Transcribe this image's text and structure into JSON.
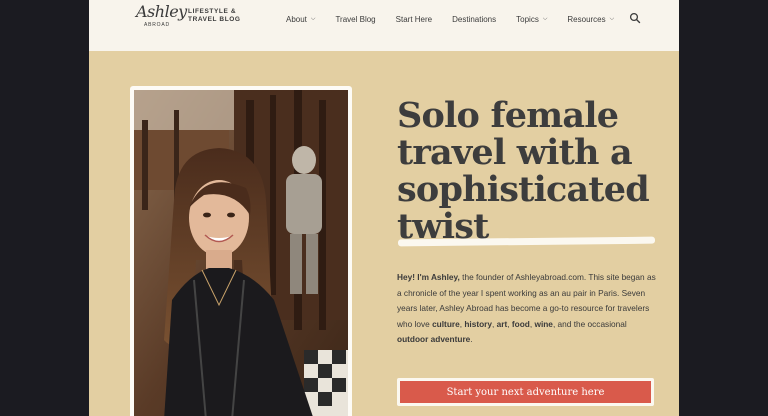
{
  "logo": {
    "script": "Ashley",
    "sub": "ABROAD",
    "tagline_line1": "LIFESTYLE &",
    "tagline_line2": "TRAVEL BLOG"
  },
  "nav": {
    "items": [
      {
        "label": "About",
        "has_dropdown": true
      },
      {
        "label": "Travel Blog",
        "has_dropdown": false
      },
      {
        "label": "Start Here",
        "has_dropdown": false
      },
      {
        "label": "Destinations",
        "has_dropdown": false
      },
      {
        "label": "Topics",
        "has_dropdown": true
      },
      {
        "label": "Resources",
        "has_dropdown": true
      }
    ],
    "search_icon": "search-icon"
  },
  "hero": {
    "title": "Solo female travel with a sophisticated twist",
    "intro": {
      "greeting": "Hey! I'm Ashley,",
      "part1": " the founder of Ashleyabroad.com. This site began as a chronicle of the year I spent working as an au pair in Paris. Seven years later, Ashley Abroad has become a go-to resource for travelers who love ",
      "culture": "culture",
      "sep1": ", ",
      "history": "history",
      "sep2": ", ",
      "art": "art",
      "sep3": ", ",
      "food": "food",
      "sep4": ", ",
      "wine": "wine",
      "part2": ", and the occasional ",
      "outdoor": "outdoor adventure",
      "end": "."
    },
    "cta_label": "Start your next adventure here"
  },
  "colors": {
    "hero_bg": "#e3cfa2",
    "header_bg": "#f8f4ec",
    "cta": "#d95a4b",
    "text": "#3d3d3d",
    "outer_bg": "#1b1b21"
  }
}
